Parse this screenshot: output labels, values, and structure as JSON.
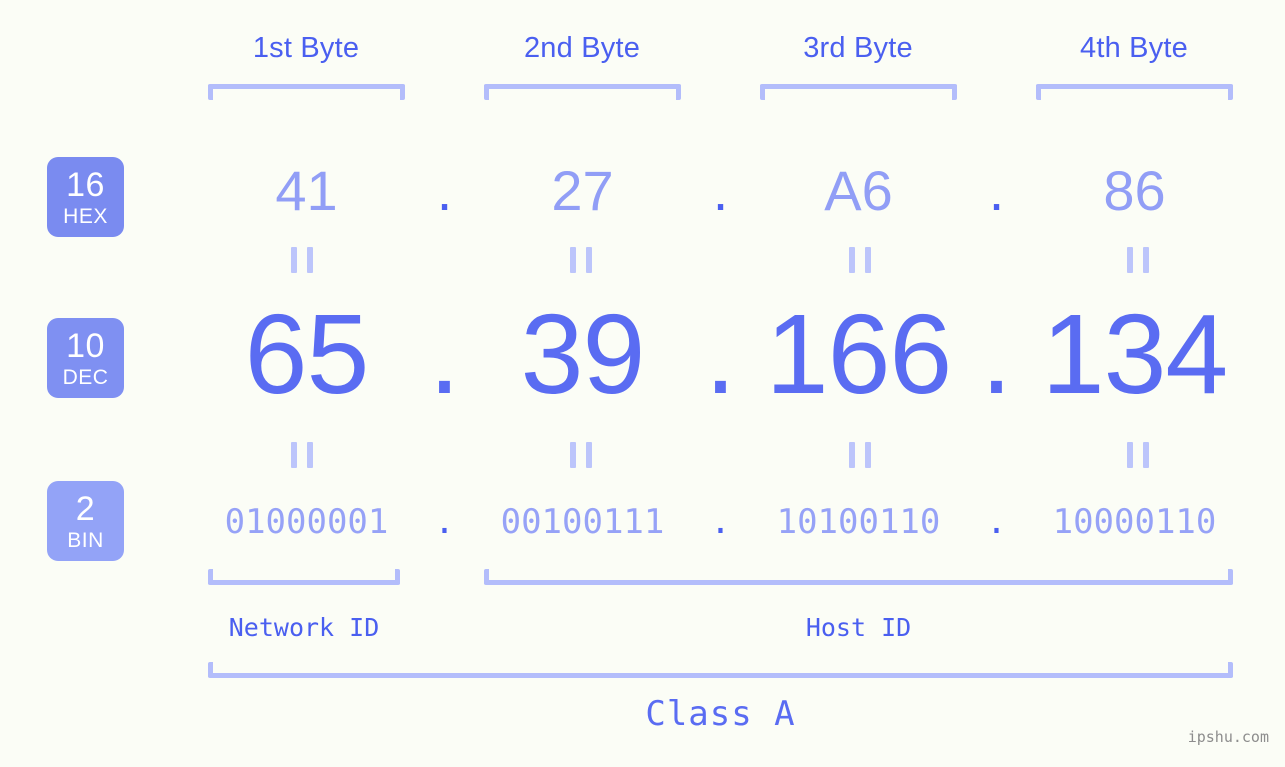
{
  "background_color": "#fbfdf6",
  "accent_color": "#4a5ff0",
  "accent_light_color": "#b3bdfb",
  "headers": {
    "bytes": [
      {
        "label": "1st Byte"
      },
      {
        "label": "2nd Byte"
      },
      {
        "label": "3rd Byte"
      },
      {
        "label": "4th Byte"
      }
    ]
  },
  "bases": [
    {
      "number": "16",
      "name": "HEX",
      "color": "#7a8bf0"
    },
    {
      "number": "10",
      "name": "DEC",
      "color": "#7f90f2"
    },
    {
      "number": "2",
      "name": "BIN",
      "color": "#93a3f7"
    }
  ],
  "separator": ".",
  "equality_mark": "=",
  "rows": {
    "hex": {
      "base_label": "HEX",
      "values": [
        "41",
        "27",
        "A6",
        "86"
      ]
    },
    "dec": {
      "base_label": "DEC",
      "values": [
        "65",
        "39",
        "166",
        "134"
      ]
    },
    "bin": {
      "base_label": "BIN",
      "values": [
        "01000001",
        "00100111",
        "10100110",
        "10000110"
      ]
    }
  },
  "segments": {
    "network_id": "Network ID",
    "host_id": "Host ID",
    "class": "Class A"
  },
  "watermark": "ipshu.com"
}
